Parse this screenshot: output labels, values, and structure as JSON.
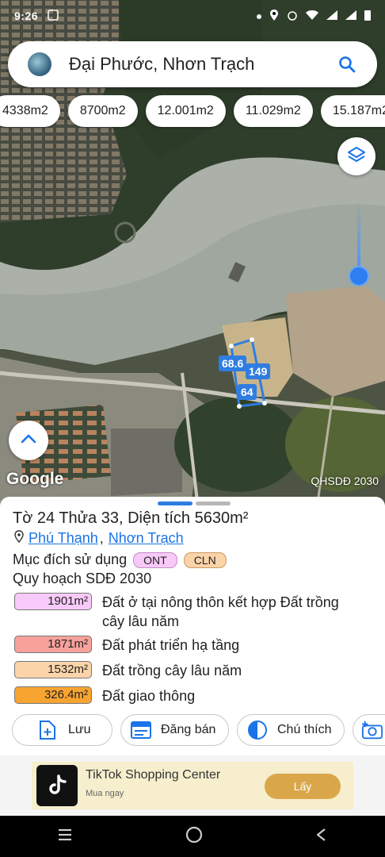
{
  "status": {
    "time": "9:26"
  },
  "search": {
    "query": "Đại Phước, Nhơn Trạch"
  },
  "area_chips": [
    "4338m2",
    "8700m2",
    "12.001m2",
    "11.029m2",
    "15.187m2"
  ],
  "map": {
    "parcel_labels": [
      "68.6",
      "149",
      "64"
    ],
    "attribution": "Google",
    "layer_label": "QHSDĐ 2030"
  },
  "parcel": {
    "title": "Tờ 24 Thửa 33, Diện tích 5630m²",
    "ward": "Phú Thạnh",
    "separator": ",",
    "district": "Nhơn Trạch",
    "purpose_label": "Mục đích sử dụng",
    "purpose_tags": [
      {
        "code": "ONT",
        "color": "#f7c9f7"
      },
      {
        "code": "CLN",
        "color": "#fbd3a8"
      }
    ],
    "plan_title": "Quy hoạch SDĐ 2030",
    "plan_rows": [
      {
        "area": "1901m²",
        "desc": "Đất ở tại nông thôn kết hợp Đất trồng cây lâu năm",
        "color": "#f8caf9"
      },
      {
        "area": "1871m²",
        "desc": "Đất phát triển hạ tầng",
        "color": "#f6a29a"
      },
      {
        "area": "1532m²",
        "desc": "Đất trồng cây lâu năm",
        "color": "#fbd5a9"
      },
      {
        "area": "326.4m²",
        "desc": "Đất giao thông",
        "color": "#f8a431"
      }
    ]
  },
  "actions": {
    "save": "Lưu",
    "post": "Đăng bán",
    "legend": "Chú thích"
  },
  "ad": {
    "title": "TikTok Shopping Center",
    "subtitle": "Mua ngay",
    "cta": "Lấy"
  },
  "colors": {
    "accent": "#1a73e8",
    "parcel": "#2f7de1"
  }
}
